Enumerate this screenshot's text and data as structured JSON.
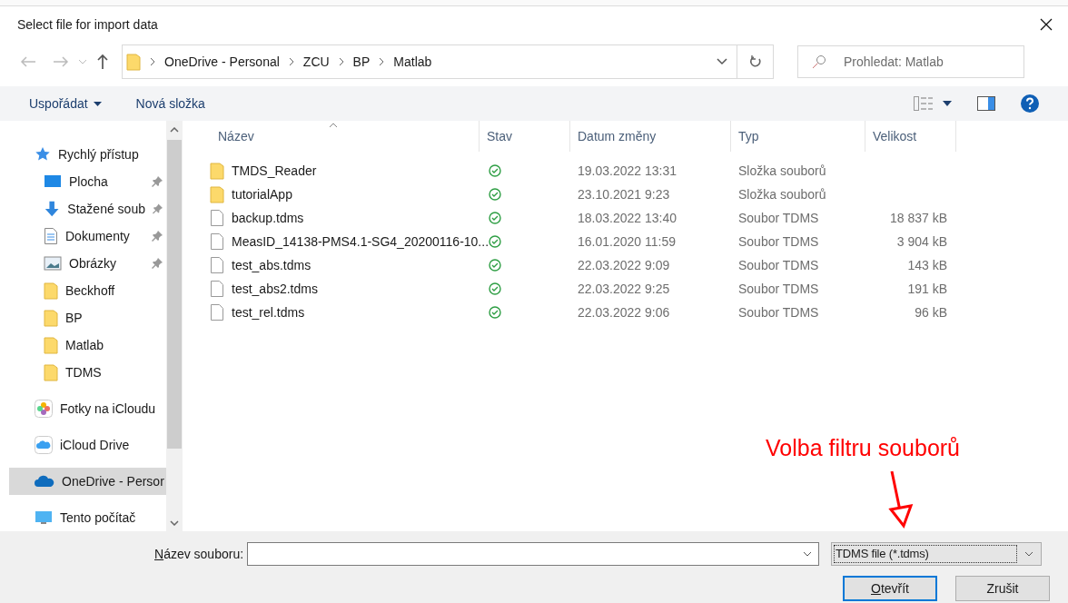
{
  "window": {
    "title": "Select file for import data"
  },
  "address": {
    "crumbs": [
      "OneDrive - Personal",
      "ZCU",
      "BP",
      "Matlab"
    ]
  },
  "search": {
    "placeholder": "Prohledat: Matlab"
  },
  "toolbar": {
    "organize": "Uspořádat",
    "new_folder": "Nová složka"
  },
  "sidebar": {
    "items": [
      {
        "kind": "quick",
        "label": "Rychlý přístup",
        "pinned": false,
        "selected": false
      },
      {
        "kind": "desktop",
        "label": "Plocha",
        "pinned": true,
        "selected": false
      },
      {
        "kind": "download",
        "label": "Stažené soub",
        "pinned": true,
        "selected": false
      },
      {
        "kind": "docs",
        "label": "Dokumenty",
        "pinned": true,
        "selected": false
      },
      {
        "kind": "pictures",
        "label": "Obrázky",
        "pinned": true,
        "selected": false
      },
      {
        "kind": "folder",
        "label": "Beckhoff",
        "pinned": false,
        "selected": false
      },
      {
        "kind": "folder",
        "label": "BP",
        "pinned": false,
        "selected": false
      },
      {
        "kind": "folder",
        "label": "Matlab",
        "pinned": false,
        "selected": false
      },
      {
        "kind": "folder",
        "label": "TDMS",
        "pinned": false,
        "selected": false
      },
      {
        "kind": "photos",
        "label": "Fotky na iCloudu",
        "pinned": false,
        "selected": false
      },
      {
        "kind": "icloud",
        "label": "iCloud Drive",
        "pinned": false,
        "selected": false
      },
      {
        "kind": "onedrive",
        "label": "OneDrive - Persor",
        "pinned": false,
        "selected": true
      },
      {
        "kind": "pc",
        "label": "Tento počítač",
        "pinned": false,
        "selected": false
      }
    ]
  },
  "table": {
    "columns": [
      "Název",
      "Stav",
      "Datum změny",
      "Typ",
      "Velikost"
    ],
    "rows": [
      {
        "kind": "folder",
        "name": "TMDS_Reader",
        "date": "19.03.2022 13:31",
        "type": "Složka souborů"
      },
      {
        "kind": "folder",
        "name": "tutorialApp",
        "date": "23.10.2021 9:23",
        "type": "Složka souborů"
      },
      {
        "kind": "file",
        "name": "backup.tdms",
        "date": "18.03.2022 13:40",
        "type": "Soubor TDMS",
        "size": "18 837 kB"
      },
      {
        "kind": "file",
        "name": "MeasID_14138-PMS4.1-SG4_20200116-10...",
        "date": "16.01.2020 11:59",
        "type": "Soubor TDMS",
        "size": "3 904 kB"
      },
      {
        "kind": "file",
        "name": "test_abs.tdms",
        "date": "22.03.2022 9:09",
        "type": "Soubor TDMS",
        "size": "143 kB"
      },
      {
        "kind": "file",
        "name": "test_abs2.tdms",
        "date": "22.03.2022 9:25",
        "type": "Soubor TDMS",
        "size": "191 kB"
      },
      {
        "kind": "file",
        "name": "test_rel.tdms",
        "date": "22.03.2022 9:06",
        "type": "Soubor TDMS",
        "size": "96 kB"
      }
    ]
  },
  "annotation": {
    "text": "Volba filtru souborů"
  },
  "footer": {
    "filename_label": "Název souboru:",
    "filter": "TDMS file (*.tdms)",
    "open": "Otevřít",
    "cancel": "Zrušit"
  }
}
